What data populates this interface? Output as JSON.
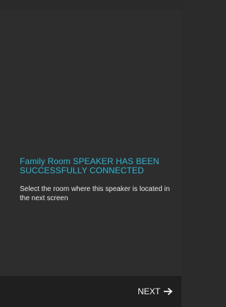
{
  "message": {
    "headline": "Family Room SPEAKER HAS BEEN SUCCESSFULLY CONNECTED",
    "description": "Select the room where this speaker is located in the next screen"
  },
  "footer": {
    "next_label": "NEXT",
    "next_icon": "arrow-right-icon"
  },
  "colors": {
    "background": "#2d2d2d",
    "footer_background": "#1f1f1f",
    "accent": "#2bb7d6",
    "text": "#e8e8e8"
  }
}
